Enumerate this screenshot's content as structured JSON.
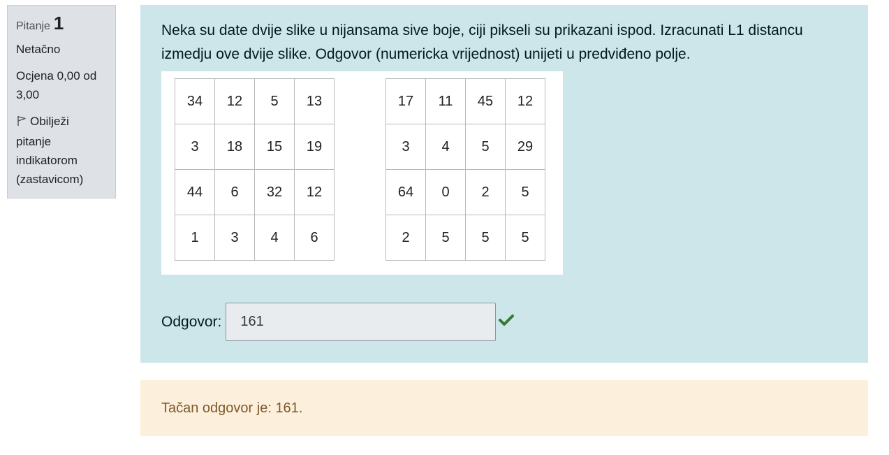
{
  "info": {
    "question_label": "Pitanje",
    "question_number": "1",
    "state": "Netačno",
    "grade": "Ocjena 0,00 od 3,00",
    "flag_label": "Obilježi pitanje indikatorom (zastavicom)"
  },
  "question": {
    "text": "Neka su date dvije slike u nijansama sive boje, ciji pikseli su prikazani ispod. Izracunati L1 distancu izmedju ove dvije slike. Odgovor (numericka vrijednost) unijeti u predviđeno polje.",
    "image_a": [
      [
        "34",
        "12",
        "5",
        "13"
      ],
      [
        "3",
        "18",
        "15",
        "19"
      ],
      [
        "44",
        "6",
        "32",
        "12"
      ],
      [
        "1",
        "3",
        "4",
        "6"
      ]
    ],
    "image_b": [
      [
        "17",
        "11",
        "45",
        "12"
      ],
      [
        "3",
        "4",
        "5",
        "29"
      ],
      [
        "64",
        "0",
        "2",
        "5"
      ],
      [
        "2",
        "5",
        "5",
        "5"
      ]
    ]
  },
  "answer": {
    "label": "Odgovor:",
    "value": "161",
    "status_icon": "check-icon",
    "status_color": "#357a32"
  },
  "feedback": {
    "right_answer": "Tačan odgovor je: 161."
  },
  "colors": {
    "formulation_bg": "#cce6ea",
    "info_bg": "#dee2e6",
    "outcome_bg": "#fcefdc",
    "outcome_text": "#7d5a29"
  }
}
